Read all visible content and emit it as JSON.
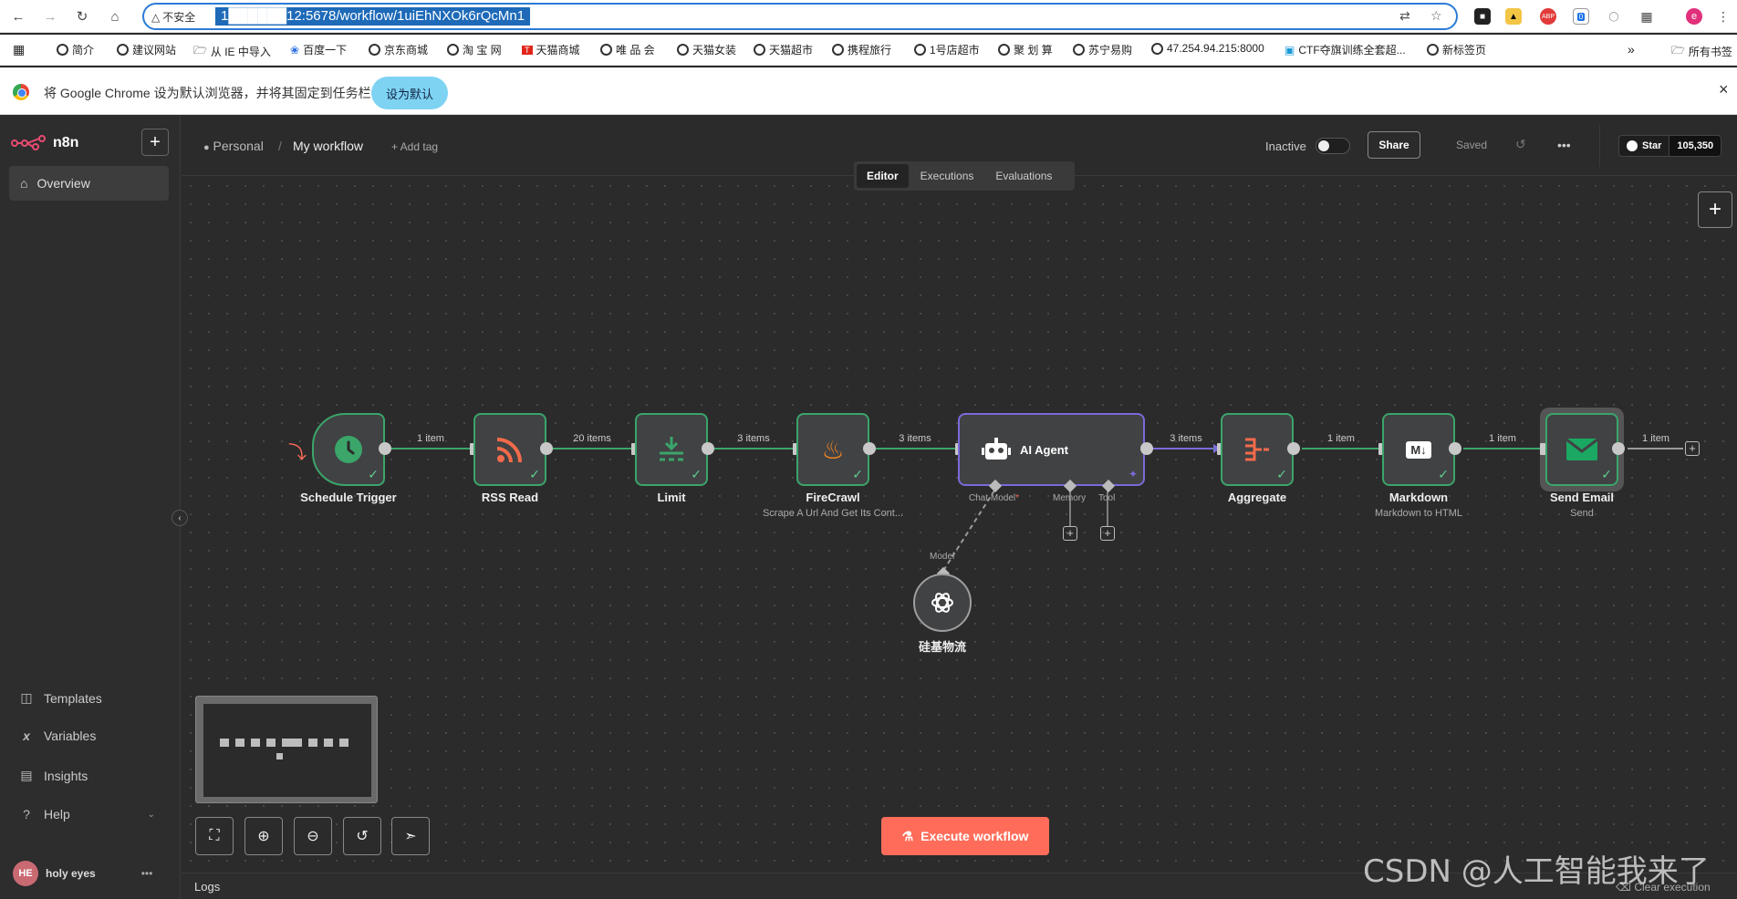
{
  "browser": {
    "security_label": "不安全",
    "url": "1██████12:5678/workflow/1uiEhNXOk6rQcMn1",
    "profile_initial": "e",
    "ext_badge": "0",
    "abp_label": "ABP"
  },
  "bookmarks": {
    "items": [
      "简介",
      "建议网站",
      "从 IE 中导入",
      "百度一下",
      "京东商城",
      "淘 宝 网",
      "天猫商城",
      "唯 品 会",
      "天猫女装",
      "天猫超市",
      "携程旅行",
      "1号店超市",
      "聚 划 算",
      "苏宁易购",
      "47.254.94.215:8000",
      "CTF夺旗训练全套超...",
      "新标签页"
    ],
    "overflow": "»",
    "all_label": "所有书签"
  },
  "infobar": {
    "message": "将 Google Chrome 设为默认浏览器，并将其固定到任务栏",
    "button": "设为默认",
    "close": "×"
  },
  "sidebar": {
    "brand": "n8n",
    "overview": "Overview",
    "templates": "Templates",
    "variables": "Variables",
    "insights": "Insights",
    "help": "Help",
    "user_initials": "HE",
    "user_name": "holy eyes",
    "more": "•••"
  },
  "header": {
    "project": "Personal",
    "separator": "/",
    "workflow_name": "My workflow",
    "add_tag": "+ Add tag",
    "status": "Inactive",
    "share": "Share",
    "saved": "Saved",
    "more": "•••",
    "github_star": "Star",
    "github_count": "105,350"
  },
  "tabs": [
    "Editor",
    "Executions",
    "Evaluations"
  ],
  "nodes": {
    "schedule": {
      "label": "Schedule Trigger"
    },
    "rss": {
      "label": "RSS Read"
    },
    "limit": {
      "label": "Limit"
    },
    "firecrawl": {
      "label": "FireCrawl",
      "subtitle": "Scrape A Url And Get Its Cont..."
    },
    "agent": {
      "label": "AI Agent",
      "chat_model": "Chat Model",
      "required": "*",
      "memory": "Memory",
      "tool": "Tool"
    },
    "aggregate": {
      "label": "Aggregate"
    },
    "markdown": {
      "label": "Markdown",
      "subtitle": "Markdown to HTML",
      "icon_text": "M↓"
    },
    "send_email": {
      "label": "Send Email",
      "subtitle": "Send"
    },
    "model": {
      "label": "硅基物流",
      "edge_label": "Model"
    }
  },
  "edges": [
    "1 item",
    "20 items",
    "3 items",
    "3 items",
    "3 items",
    "1 item",
    "1 item",
    "1 item"
  ],
  "execute_button": "Execute workflow",
  "logs": {
    "label": "Logs",
    "clear": "Clear execution"
  },
  "watermark": "CSDN @人工智能我来了",
  "colors": {
    "success": "#3ba56a",
    "agent": "#7a6bd9",
    "execute": "#ff6d5a",
    "canvas": "#2b2b2b"
  }
}
